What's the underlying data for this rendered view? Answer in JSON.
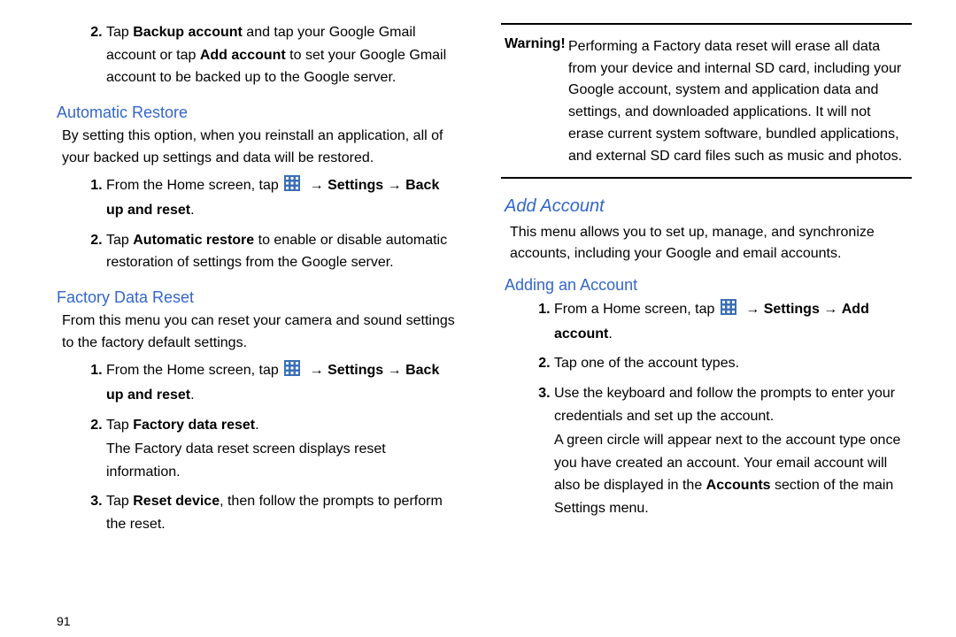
{
  "left": {
    "step2_top": {
      "pre": "Tap ",
      "b1": "Backup account",
      "mid1": " and tap your Google Gmail account or tap ",
      "b2": "Add account",
      "tail": " to set your Google Gmail account to be backed up to the Google server."
    },
    "auto_restore": {
      "title": "Automatic Restore",
      "intro": "By setting this option, when you reinstall an application, all of your backed up settings and data will be restored.",
      "s1_pre": "From the Home screen, tap ",
      "s1_b1": "Settings",
      "s1_arrow": " → ",
      "s1_b2": "Back up and reset",
      "s1_tail": ".",
      "s2_pre": "Tap ",
      "s2_b1": "Automatic restore",
      "s2_tail": " to enable or disable automatic restoration of settings from the Google server."
    },
    "factory": {
      "title": "Factory Data Reset",
      "intro": "From this menu you can reset your camera and sound settings to the factory default settings.",
      "s1_pre": "From the Home screen, tap ",
      "s1_b1": "Settings",
      "s1_arrow": " → ",
      "s1_b2": "Back up and reset",
      "s1_tail": ".",
      "s2_pre": "Tap ",
      "s2_b1": "Factory data reset",
      "s2_tail": ".",
      "s2_sub": "The Factory data reset screen displays reset information.",
      "s3_pre": "Tap ",
      "s3_b1": "Reset device",
      "s3_tail": ", then follow the prompts to perform the reset."
    },
    "page_num": "91"
  },
  "right": {
    "warning": {
      "label": "Warning!",
      "body": " Performing a Factory data reset will erase all data from your device and internal SD card, including your Google account, system and application data and settings, and downloaded applications. It will not erase current system software, bundled applications, and external SD card files such as music and photos."
    },
    "add_account": {
      "title": "Add Account",
      "intro": "This menu allows you to set up, manage, and synchronize accounts, including your Google and email accounts.",
      "sub_title": "Adding an Account",
      "s1_pre": "From a Home screen, tap ",
      "s1_b1": "Settings",
      "s1_arrow": " → ",
      "s1_b2": "Add account",
      "s1_tail": ".",
      "s2": "Tap one of the account types.",
      "s3": "Use the keyboard and follow the prompts to enter your credentials and set up the account.",
      "s3_sub_pre": "A green circle will appear next to the account type once you have created an account. Your email account will also be displayed in the ",
      "s3_sub_b": "Accounts",
      "s3_sub_tail": " section of the main Settings menu."
    }
  }
}
